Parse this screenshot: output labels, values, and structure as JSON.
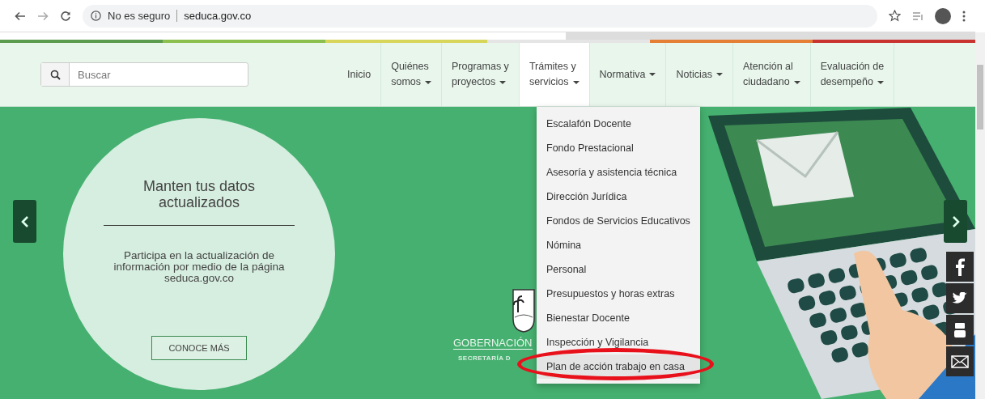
{
  "browser": {
    "security": "No es seguro",
    "url": "seduca.gov.co"
  },
  "search": {
    "placeholder": "Buscar"
  },
  "nav": [
    {
      "lines": [
        "Inicio"
      ],
      "dropdown": false,
      "expanded": false
    },
    {
      "lines": [
        "Quiénes",
        "somos"
      ],
      "dropdown": true,
      "expanded": false
    },
    {
      "lines": [
        "Programas y",
        "proyectos"
      ],
      "dropdown": true,
      "expanded": false
    },
    {
      "lines": [
        "Trámites y",
        "servicios"
      ],
      "dropdown": true,
      "expanded": true
    },
    {
      "lines": [
        "Normativa"
      ],
      "dropdown": true,
      "expanded": false
    },
    {
      "lines": [
        "Noticias"
      ],
      "dropdown": true,
      "expanded": false
    },
    {
      "lines": [
        "Atención al",
        "ciudadano"
      ],
      "dropdown": true,
      "expanded": false
    },
    {
      "lines": [
        "Evaluación de",
        "desempeño"
      ],
      "dropdown": true,
      "expanded": false
    }
  ],
  "menu": [
    {
      "label": "Escalafón Docente",
      "selected": false
    },
    {
      "label": "Fondo Prestacional",
      "selected": false
    },
    {
      "label": "Asesoría y asistencia técnica",
      "selected": false
    },
    {
      "label": "Dirección Jurídica",
      "selected": false
    },
    {
      "label": "Fondos de Servicios Educativos",
      "selected": false
    },
    {
      "label": "Nómina",
      "selected": false
    },
    {
      "label": "Personal",
      "selected": false
    },
    {
      "label": "Presupuestos y horas extras",
      "selected": false
    },
    {
      "label": "Bienestar Docente",
      "selected": false
    },
    {
      "label": "Inspección y Vigilancia",
      "selected": false
    },
    {
      "label": "Plan de acción trabajo en casa",
      "selected": true
    }
  ],
  "slide": {
    "title": "Manten tus datos actualizados",
    "text": "Participa en la actualización de información por medio de la página seduca.gov.co",
    "button": "CONOCE MÁS"
  },
  "logo": {
    "name": "GOBERNACIÓN",
    "subtitle": "SECRETARÍA D"
  }
}
